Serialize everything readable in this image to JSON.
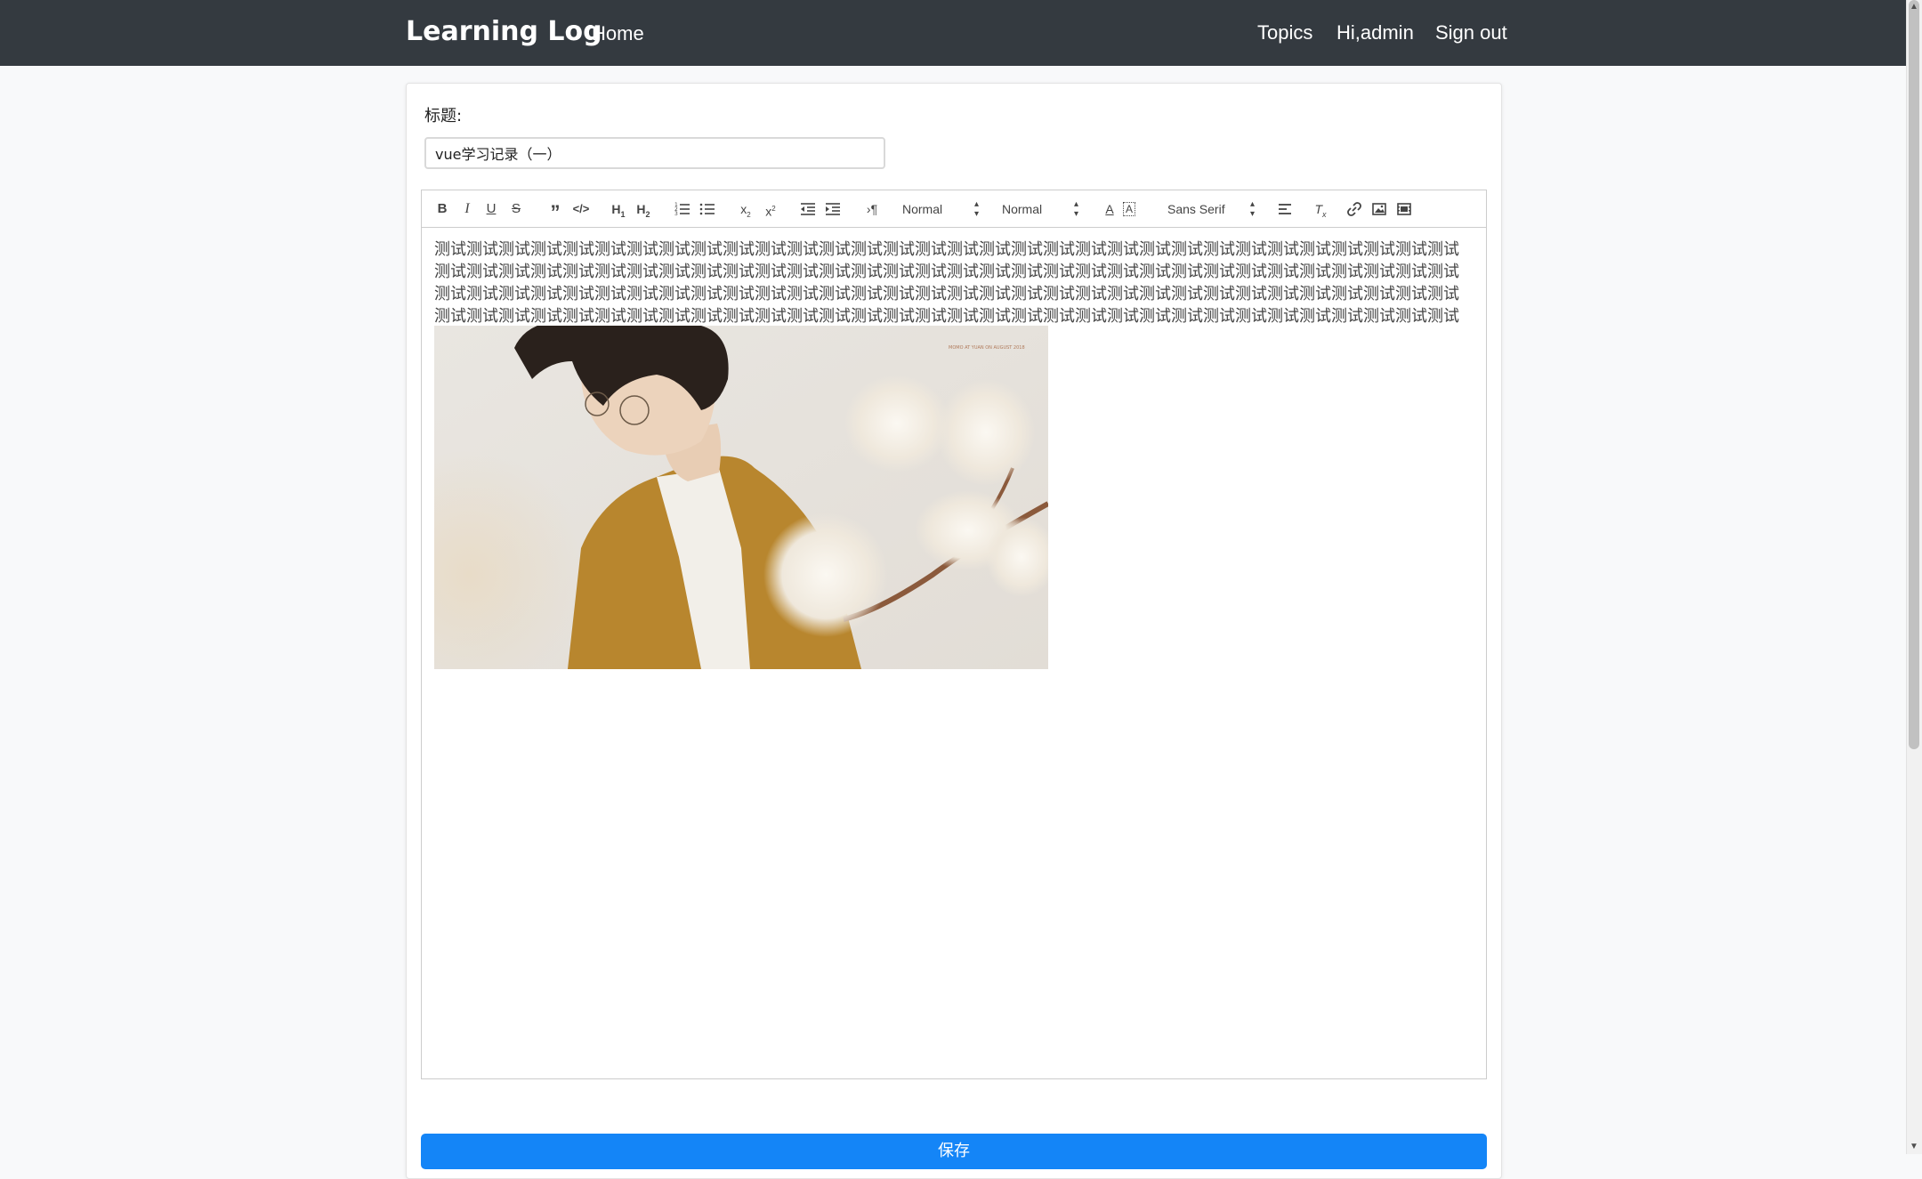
{
  "navbar": {
    "brand": "Learning Log",
    "home": "Home",
    "topics": "Topics",
    "user": "Hi,admin",
    "signout": "Sign out"
  },
  "form": {
    "title_label": "标题:",
    "title_value": "vue学习记录（一）",
    "save_label": "保存"
  },
  "toolbar": {
    "header_picker": "Normal",
    "size_picker": "Normal",
    "font_picker": "Sans Serif",
    "h1": "H1",
    "h2": "H2"
  },
  "content": {
    "text": "测试测试测试测试测试测试测试测试测试测试测试测试测试测试测试测试测试测试测试测试测试测试测试测试测试测试测试测试测试测试测试测试测试测试测试测试测试测试测试测试测试测试测试测试测试测试测试测试测试测试测试测试测试测试测试测试测试测试测试测试测试测试测试测试测试测试测试测试测试测试测试测试测试测试测试测试测试测试测试测试测试测试测试测试测试测试测试测试测试测试测试测试测试测试测试测试测试测试测试测试测试测试测试测试测试测试测试测试测试测试测试测试测试测试测试测试测试测试测试测试测试测试测试测试测试测试测试测试测试测试测试测试测试测试测试测试测试",
    "image_caption": "MOMO AT YUAN ON AUGUST 2018"
  }
}
